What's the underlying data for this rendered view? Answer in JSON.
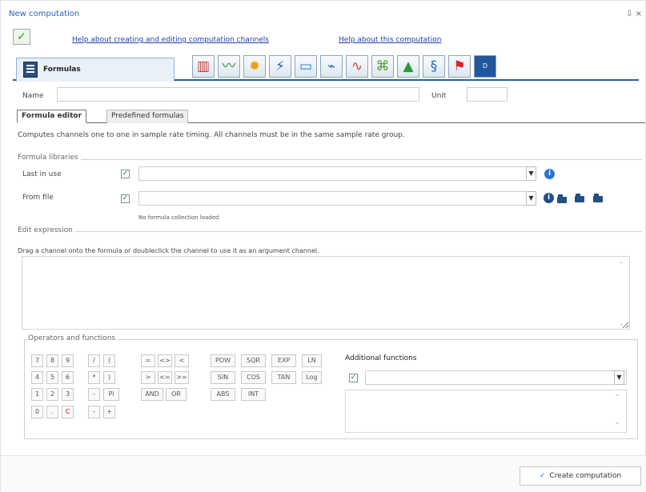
{
  "window": {
    "title": "New computation",
    "controls": "⇩ ×"
  },
  "links": {
    "help_channels": "Help about creating and editing computation channels",
    "help_computation": "Help about this computation"
  },
  "main_tab": {
    "label": "Formulas"
  },
  "tool_icons": [
    "scope-icon",
    "spectrum-icon",
    "yellow-gear-icon",
    "filter-icon",
    "display-icon",
    "graph-icon",
    "wave-icon",
    "network-icon",
    "mountain-icon",
    "script-icon",
    "red-tag-icon",
    "dsp-icon"
  ],
  "fields": {
    "name_label": "Name",
    "unit_label": "Unit",
    "name_value": "",
    "unit_value": ""
  },
  "subtabs": {
    "active": "Formula editor",
    "inactive": "Predefined formulas"
  },
  "description": "Computes channels one to one in sample rate timing. All channels must be in the same sample rate group.",
  "formula_libraries": {
    "title": "Formula libraries",
    "last_in_use": "Last in use",
    "from_file": "From file",
    "no_collection": "No formula collection loaded"
  },
  "edit_expression": {
    "title": "Edit expression",
    "hint": "Drag a channel onto the formula or doubleclick the channel to use it as an argument channel."
  },
  "operators": {
    "title": "Operators and functions",
    "numbers": [
      "7",
      "8",
      "9",
      "4",
      "5",
      "6",
      "1",
      "2",
      "3",
      "0",
      ".",
      "C"
    ],
    "symbols": [
      "/",
      "(",
      "*",
      ")",
      "-",
      "Pi",
      "-",
      "+",
      "=",
      "<>",
      "<",
      ">",
      "<=",
      ">=",
      "AND",
      "OR"
    ],
    "functions": [
      "POW",
      "SQR",
      "EXP",
      "LN",
      "SIN",
      "COS",
      "TAN",
      "Log",
      "ABS",
      "INT"
    ],
    "additional_label": "Additional functions"
  },
  "footer": {
    "create_button": "Create computation"
  }
}
